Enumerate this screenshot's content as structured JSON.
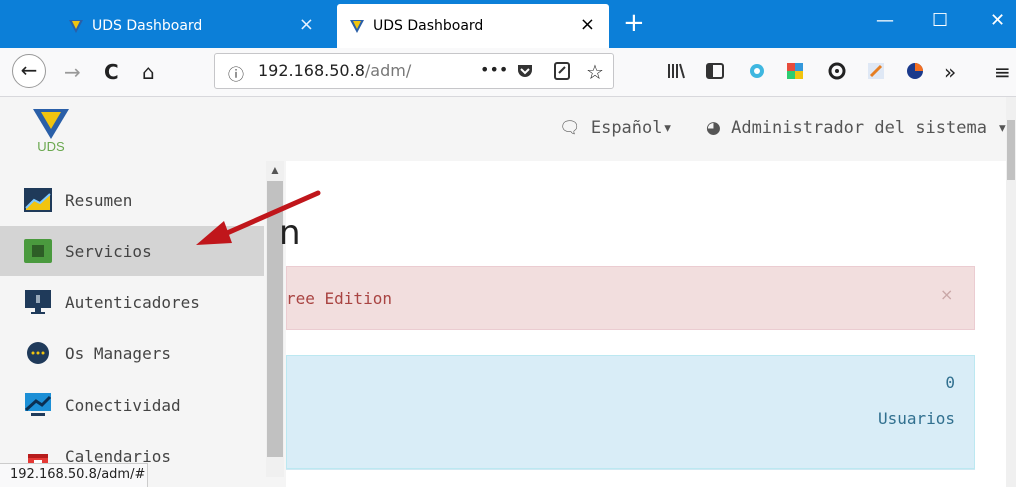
{
  "tabs": [
    {
      "title": "UDS Dashboard",
      "close": "×"
    },
    {
      "title": "UDS Dashboard",
      "close": "×"
    }
  ],
  "new_tab": "+",
  "window_controls": {
    "minimize": "—",
    "maximize": "☐",
    "close": "✕"
  },
  "nav": {
    "back": "←",
    "forward": "→",
    "reload": "C",
    "home": "⌂",
    "url_info": "ⓘ",
    "url_host": "192.168.50.8",
    "url_path": "/adm/",
    "page_actions": "•••",
    "more_tools": "»",
    "menu": "≡"
  },
  "header": {
    "logo_text": "UDS",
    "language": "Español",
    "user": "Administrador del sistema"
  },
  "sidebar": {
    "items": [
      {
        "label": "Resumen",
        "icon": "summary-chart-icon",
        "active": false
      },
      {
        "label": "Servicios",
        "icon": "services-board-icon",
        "active": true
      },
      {
        "label": "Autenticadores",
        "icon": "authenticator-monitor-icon",
        "active": false
      },
      {
        "label": "Os Managers",
        "icon": "os-managers-dots-icon",
        "active": false
      },
      {
        "label": "Conectividad",
        "icon": "connectivity-monitor-icon",
        "active": false
      },
      {
        "label": "Calendarios",
        "icon": "calendar-icon",
        "active": false
      }
    ]
  },
  "main": {
    "heading_fragment": "n",
    "alert": {
      "text": "ree Edition",
      "close": "×"
    },
    "panel": {
      "count": "0",
      "label": "Usuarios"
    }
  },
  "status_bar": {
    "text": "192.168.50.8/adm/#"
  },
  "colors": {
    "tabbar": "#0c7fd8",
    "alert_bg": "#f2dede",
    "alert_text": "#a94442",
    "panel_bg": "#d9edf7",
    "panel_text": "#31708f",
    "arrow": "#c0161b"
  }
}
